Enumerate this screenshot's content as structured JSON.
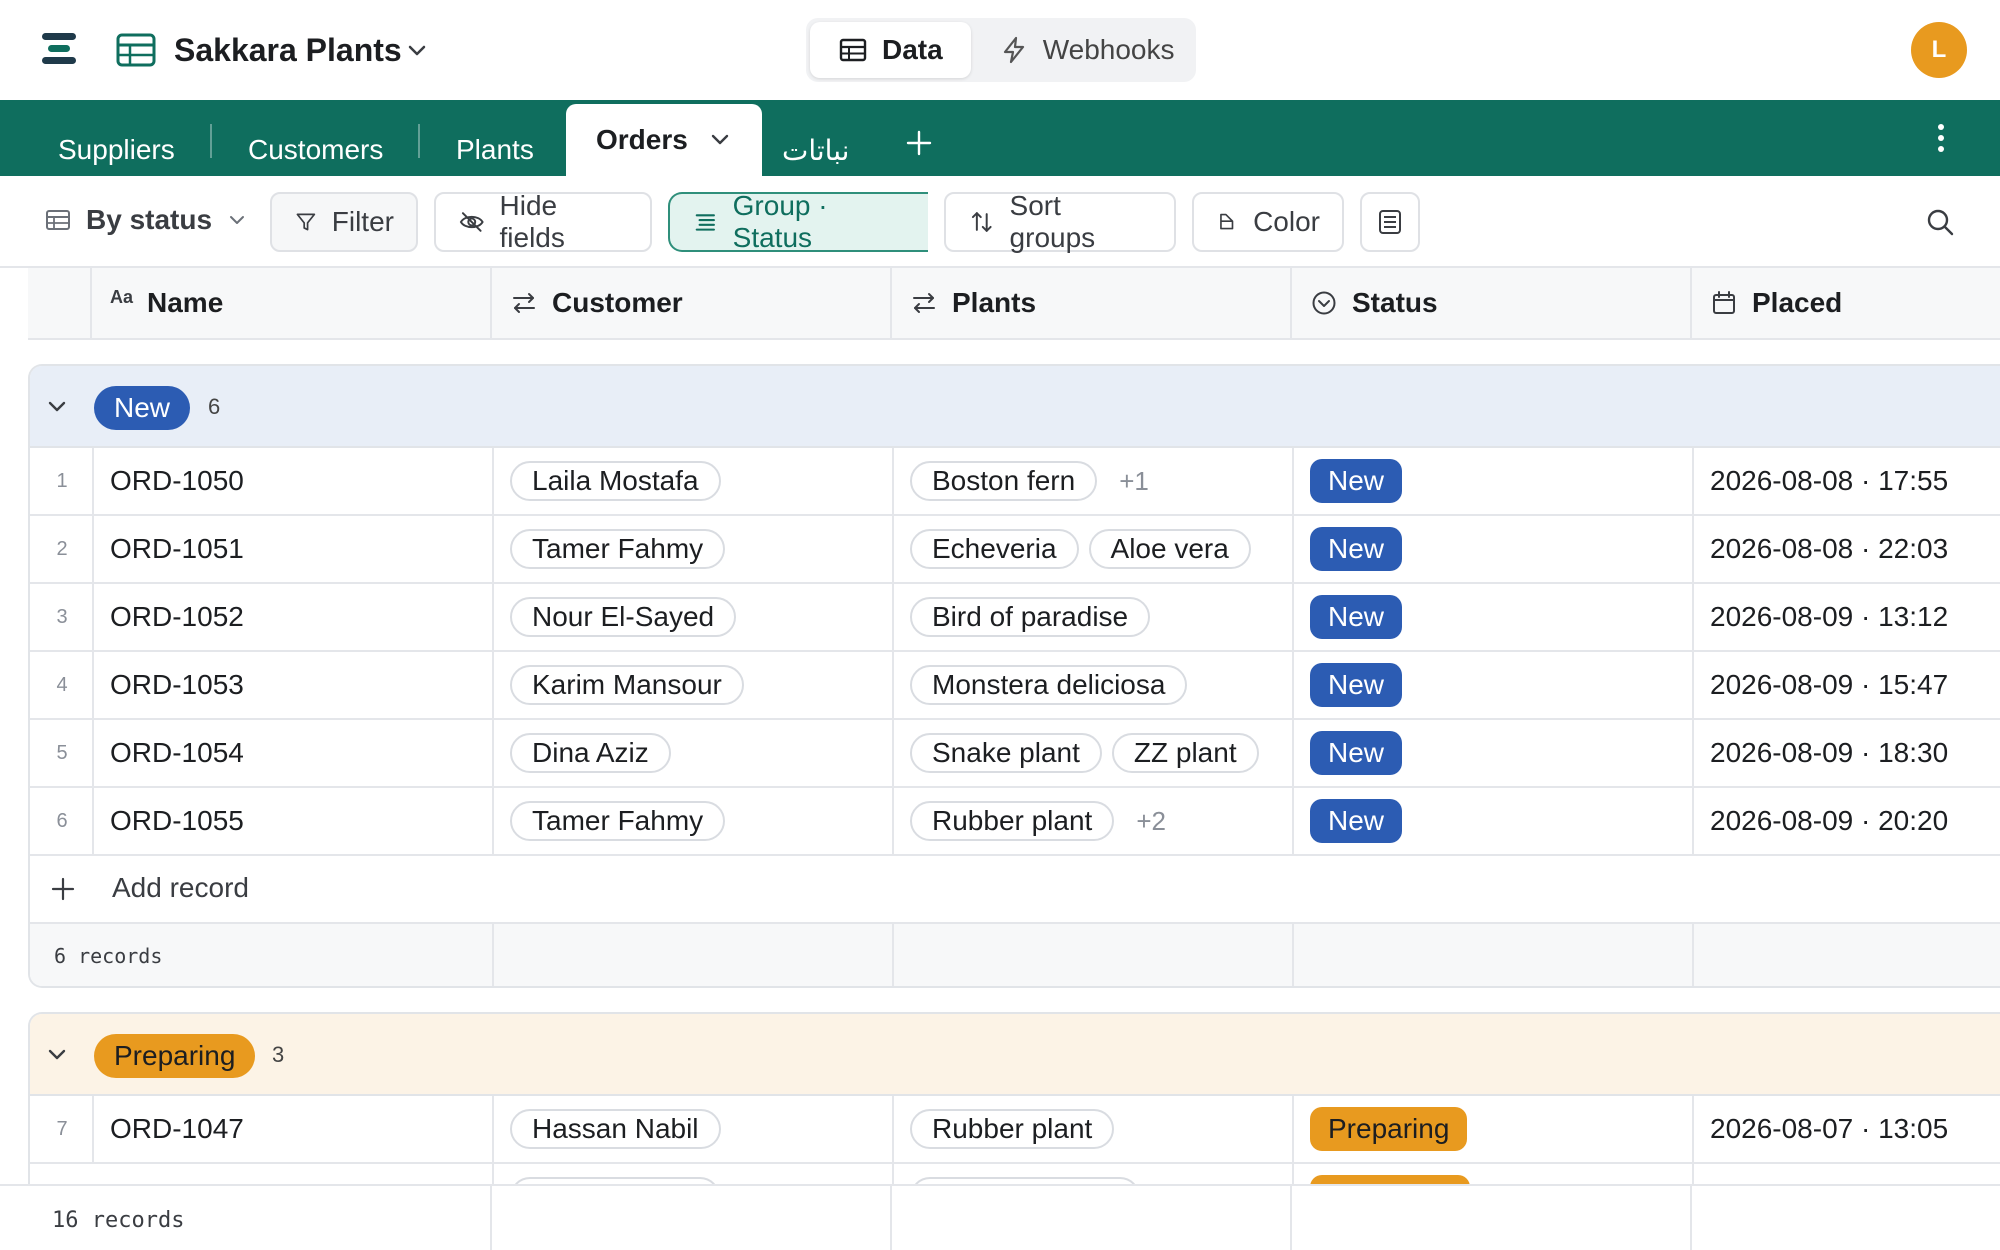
{
  "app": {
    "base_name": "Sakkara Plants",
    "avatar_initial": "L",
    "modes": [
      {
        "label": "Data"
      },
      {
        "label": "Webhooks"
      }
    ]
  },
  "tables": [
    {
      "label": "Suppliers"
    },
    {
      "label": "Customers"
    },
    {
      "label": "Plants"
    },
    {
      "label": "Orders"
    },
    {
      "label": "نباتات"
    }
  ],
  "toolbar": {
    "view_name": "By status",
    "filter": "Filter",
    "hide_fields": "Hide fields",
    "group": "Group · Status",
    "sort_groups": "Sort groups",
    "color": "Color"
  },
  "columns": [
    {
      "label": "Name",
      "icon": "text-type-icon"
    },
    {
      "label": "Customer",
      "icon": "link-arrows-icon"
    },
    {
      "label": "Plants",
      "icon": "link-arrows-icon"
    },
    {
      "label": "Status",
      "icon": "status-select-icon"
    },
    {
      "label": "Placed",
      "icon": "calendar-icon"
    }
  ],
  "colors": {
    "brand": "#0f6e5e",
    "status_new": "#2c5cb3",
    "status_preparing": "#e89a1f"
  },
  "groups": [
    {
      "status": "New",
      "count": "6",
      "add_label": "Add record",
      "footer": "6 records",
      "rows": [
        {
          "num": "1",
          "name": "ORD-1050",
          "customer": "Laila Mostafa",
          "plants": [
            "Boston fern"
          ],
          "more": "+1",
          "status": "New",
          "placed": "2026-08-08 · 17:55"
        },
        {
          "num": "2",
          "name": "ORD-1051",
          "customer": "Tamer Fahmy",
          "plants": [
            "Echeveria",
            "Aloe vera"
          ],
          "more": "",
          "status": "New",
          "placed": "2026-08-08 · 22:03"
        },
        {
          "num": "3",
          "name": "ORD-1052",
          "customer": "Nour El-Sayed",
          "plants": [
            "Bird of paradise"
          ],
          "more": "",
          "status": "New",
          "placed": "2026-08-09 · 13:12"
        },
        {
          "num": "4",
          "name": "ORD-1053",
          "customer": "Karim Mansour",
          "plants": [
            "Monstera deliciosa"
          ],
          "more": "",
          "status": "New",
          "placed": "2026-08-09 · 15:47"
        },
        {
          "num": "5",
          "name": "ORD-1054",
          "customer": "Dina Aziz",
          "plants": [
            "Snake plant",
            "ZZ plant"
          ],
          "more": "",
          "status": "New",
          "placed": "2026-08-09 · 18:30"
        },
        {
          "num": "6",
          "name": "ORD-1055",
          "customer": "Tamer Fahmy",
          "plants": [
            "Rubber plant"
          ],
          "more": "+2",
          "status": "New",
          "placed": "2026-08-09 · 20:20"
        }
      ]
    },
    {
      "status": "Preparing",
      "count": "3",
      "rows": [
        {
          "num": "7",
          "name": "ORD-1047",
          "customer": "Hassan Nabil",
          "plants": [
            "Rubber plant"
          ],
          "more": "",
          "status": "Preparing",
          "placed": "2026-08-07 · 13:05"
        }
      ]
    }
  ],
  "footer": {
    "total": "16 records"
  }
}
